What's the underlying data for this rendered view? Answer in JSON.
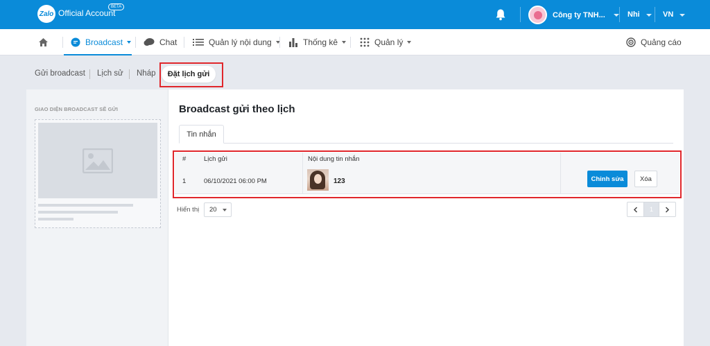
{
  "topbar": {
    "logo_badge": "Zalo",
    "logo_text": "Official Account",
    "beta": "BETA",
    "company_name": "Công ty TNH...",
    "user_name": "Nhi",
    "language": "VN"
  },
  "nav": {
    "items": [
      {
        "label": "Broadcast",
        "icon": "broadcast-icon"
      },
      {
        "label": "Chat",
        "icon": "chat-icon"
      },
      {
        "label": "Quản lý nội dung",
        "icon": "list-icon"
      },
      {
        "label": "Thống kê",
        "icon": "bar-chart-icon"
      },
      {
        "label": "Quản lý",
        "icon": "grid-icon"
      }
    ],
    "ads": "Quảng cáo"
  },
  "subtabs": [
    "Gửi broadcast",
    "Lịch sử",
    "Nháp",
    "Đặt lịch gửi"
  ],
  "preview": {
    "label": "GIAO DIỆN BROADCAST SẼ GỬI"
  },
  "main": {
    "title": "Broadcast gửi theo lịch",
    "tab": "Tin nhắn",
    "headers": {
      "index": "#",
      "schedule": "Lịch gửi",
      "content": "Nội dung tin nhắn"
    },
    "rows": [
      {
        "index": "1",
        "schedule": "06/10/2021 06:00 PM",
        "content": "123",
        "edit": "Chỉnh sửa",
        "delete": "Xóa"
      }
    ],
    "page_size_label": "Hiển thị",
    "page_size": "20",
    "current_page": "1"
  },
  "colors": {
    "primary": "#0a8bd9",
    "highlight": "#e0262b"
  }
}
